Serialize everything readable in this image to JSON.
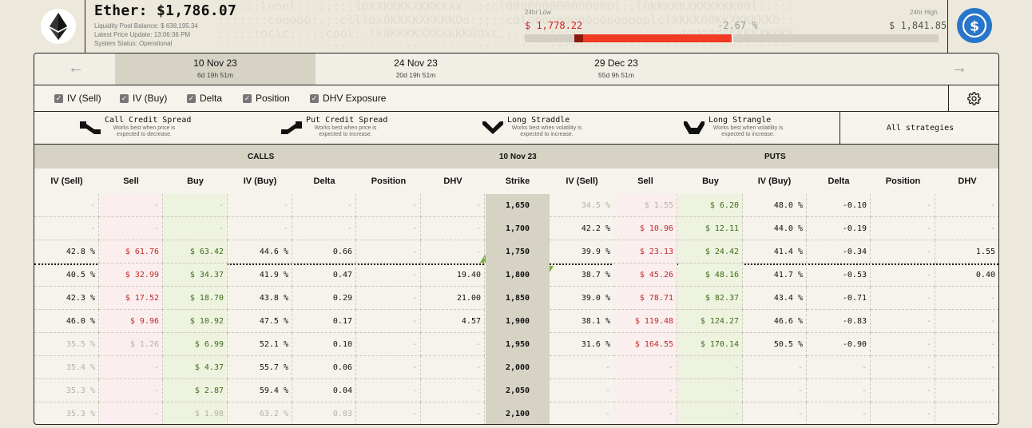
{
  "asset": {
    "name": "Ether",
    "title": "Ether: $1,786.07",
    "liquidity": "Liquidity Pool Balance: $ 638,195.34",
    "price_update": "Latest Price Update: 13:06:36 PM",
    "status": "System Status: Operational"
  },
  "range": {
    "low_label": "24hr Low",
    "high_label": "24hr High",
    "low": "$ 1,778.22",
    "change": "-2.67 %",
    "high": "$ 1,841.85",
    "position": 0.12
  },
  "colors": {
    "sell": "#c02a2a",
    "buy": "#3c6b1a",
    "range_fill": "#f23b25",
    "usdc": "#2775ca",
    "atm_marker": "#6fb32e"
  },
  "icons": {
    "eth": "ethereum-icon",
    "usdc": "usdc-icon",
    "prev": "arrow-left-icon",
    "next": "arrow-right-icon",
    "settings": "gear-icon",
    "check": "checkbox-checked-icon"
  },
  "expiries": [
    {
      "date": "10 Nov 23",
      "ttl": "6d 19h 51m",
      "active": true
    },
    {
      "date": "24 Nov 23",
      "ttl": "20d 19h 51m",
      "active": false
    },
    {
      "date": "29 Dec 23",
      "ttl": "55d 9h 51m",
      "active": false
    }
  ],
  "toggles": [
    "IV (Sell)",
    "IV (Buy)",
    "Delta",
    "Position",
    "DHV Exposure"
  ],
  "strategies": [
    {
      "name": "Call Credit Spread",
      "desc": "Works best when price is expected to decrease."
    },
    {
      "name": "Put Credit Spread",
      "desc": "Works best when price is expected to increase."
    },
    {
      "name": "Long Straddle",
      "desc": "Works best when volatility is expected to increase."
    },
    {
      "name": "Long Strangle",
      "desc": "Works best when volatility is expected to increase."
    }
  ],
  "all_strategies": "All strategies",
  "sections": {
    "calls": "CALLS",
    "expiry": "10 Nov 23",
    "puts": "PUTS"
  },
  "columns": {
    "calls": [
      "IV (Sell)",
      "Sell",
      "Buy",
      "IV (Buy)",
      "Delta",
      "Position",
      "DHV"
    ],
    "strike": "Strike",
    "puts": [
      "IV (Sell)",
      "Sell",
      "Buy",
      "IV (Buy)",
      "Delta",
      "Position",
      "DHV"
    ]
  },
  "rows": [
    {
      "strike": "1,650",
      "calls": [
        "-",
        "-",
        "-",
        "-",
        "-",
        "-",
        "-"
      ],
      "calls_dim": true,
      "puts": [
        "34.5 %",
        "$ 1.55",
        "$ 6.20",
        "48.0 %",
        "-0.10",
        "-",
        "-"
      ],
      "puts_dim": "partial"
    },
    {
      "strike": "1,700",
      "calls": [
        "-",
        "-",
        "-",
        "-",
        "-",
        "-",
        "-"
      ],
      "calls_dim": true,
      "puts": [
        "42.2 %",
        "$ 10.96",
        "$ 12.11",
        "44.0 %",
        "-0.19",
        "-",
        "-"
      ],
      "puts_dim": false
    },
    {
      "strike": "1,750",
      "calls": [
        "42.8 %",
        "$ 61.76",
        "$ 63.42",
        "44.6 %",
        "0.66",
        "-",
        "-"
      ],
      "calls_dim": false,
      "puts": [
        "39.9 %",
        "$ 23.13",
        "$ 24.42",
        "41.4 %",
        "-0.34",
        "-",
        "1.55"
      ],
      "puts_dim": false
    },
    {
      "strike": "1,800",
      "calls": [
        "40.5 %",
        "$ 32.99",
        "$ 34.37",
        "41.9 %",
        "0.47",
        "-",
        "19.40"
      ],
      "calls_dim": false,
      "puts": [
        "38.7 %",
        "$ 45.26",
        "$ 48.16",
        "41.7 %",
        "-0.53",
        "-",
        "0.40"
      ],
      "puts_dim": false
    },
    {
      "strike": "1,850",
      "calls": [
        "42.3 %",
        "$ 17.52",
        "$ 18.70",
        "43.8 %",
        "0.29",
        "-",
        "21.00"
      ],
      "calls_dim": false,
      "puts": [
        "39.0 %",
        "$ 78.71",
        "$ 82.37",
        "43.4 %",
        "-0.71",
        "-",
        "-"
      ],
      "puts_dim": false
    },
    {
      "strike": "1,900",
      "calls": [
        "46.0 %",
        "$ 9.96",
        "$ 10.92",
        "47.5 %",
        "0.17",
        "-",
        "4.57"
      ],
      "calls_dim": false,
      "puts": [
        "38.1 %",
        "$ 119.48",
        "$ 124.27",
        "46.6 %",
        "-0.83",
        "-",
        "-"
      ],
      "puts_dim": false
    },
    {
      "strike": "1,950",
      "calls": [
        "35.5 %",
        "$ 1.26",
        "$ 6.99",
        "52.1 %",
        "0.10",
        "-",
        "-"
      ],
      "calls_dim": "partial",
      "puts": [
        "31.6 %",
        "$ 164.55",
        "$ 170.14",
        "50.5 %",
        "-0.90",
        "-",
        "-"
      ],
      "puts_dim": false
    },
    {
      "strike": "2,000",
      "calls": [
        "35.4 %",
        "-",
        "$ 4.37",
        "55.7 %",
        "0.06",
        "-",
        "-"
      ],
      "calls_dim": "partial",
      "puts": [
        "-",
        "-",
        "-",
        "-",
        "-",
        "-",
        "-"
      ],
      "puts_dim": true
    },
    {
      "strike": "2,050",
      "calls": [
        "35.3 %",
        "-",
        "$ 2.87",
        "59.4 %",
        "0.04",
        "-",
        "-"
      ],
      "calls_dim": "partial",
      "puts": [
        "-",
        "-",
        "-",
        "-",
        "-",
        "-",
        "-"
      ],
      "puts_dim": true
    },
    {
      "strike": "2,100",
      "calls": [
        "35.3 %",
        "-",
        "$ 1.98",
        "63.2 %",
        "0.03",
        "-",
        "-"
      ],
      "calls_dim": "full",
      "puts": [
        "-",
        "-",
        "-",
        "-",
        "-",
        "-",
        "-"
      ],
      "puts_dim": true
    }
  ]
}
